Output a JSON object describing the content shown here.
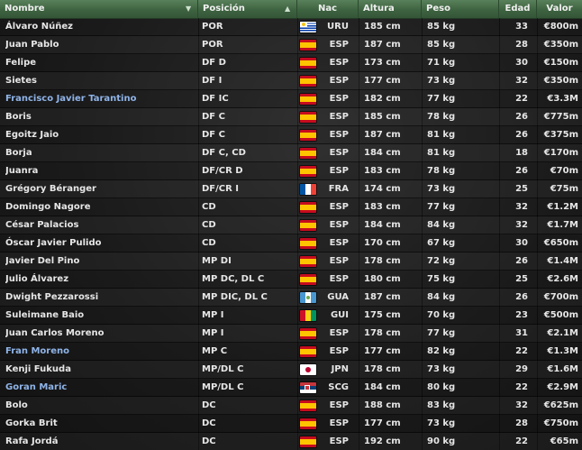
{
  "header": {
    "columns": [
      {
        "key": "nombre",
        "label": "Nombre"
      },
      {
        "key": "posicion",
        "label": "Posición"
      },
      {
        "key": "nac",
        "label": "Nac"
      },
      {
        "key": "altura",
        "label": "Altura"
      },
      {
        "key": "peso",
        "label": "Peso"
      },
      {
        "key": "edad",
        "label": "Edad"
      },
      {
        "key": "valor",
        "label": "Valor"
      }
    ],
    "nombre_filter_icon": "▼",
    "sort_icon": "▲"
  },
  "flags": {
    "ESP": "spain-flag-icon",
    "URU": "uruguay-flag-icon",
    "FRA": "france-flag-icon",
    "GUA": "guatemala-flag-icon",
    "GUI": "guinea-flag-icon",
    "JPN": "japan-flag-icon",
    "SCG": "serbia-montenegro-flag-icon"
  },
  "colors": {
    "header_green": "#4a6f4b",
    "highlight_name": "#8fb4e8",
    "text": "#e6e6e6"
  },
  "players": [
    {
      "nombre": "Álvaro Núñez",
      "posicion": "POR",
      "nac": "URU",
      "altura": "185 cm",
      "peso": "85 kg",
      "edad": "33",
      "valor": "€800m",
      "highlight": false
    },
    {
      "nombre": "Juan Pablo",
      "posicion": "POR",
      "nac": "ESP",
      "altura": "187 cm",
      "peso": "85 kg",
      "edad": "28",
      "valor": "€350m",
      "highlight": false
    },
    {
      "nombre": "Felipe",
      "posicion": "DF D",
      "nac": "ESP",
      "altura": "173 cm",
      "peso": "71 kg",
      "edad": "30",
      "valor": "€150m",
      "highlight": false
    },
    {
      "nombre": "Sietes",
      "posicion": "DF I",
      "nac": "ESP",
      "altura": "177 cm",
      "peso": "73 kg",
      "edad": "32",
      "valor": "€350m",
      "highlight": false
    },
    {
      "nombre": "Francisco Javier Tarantino",
      "posicion": "DF IC",
      "nac": "ESP",
      "altura": "182 cm",
      "peso": "77 kg",
      "edad": "22",
      "valor": "€3.3M",
      "highlight": true
    },
    {
      "nombre": "Boris",
      "posicion": "DF C",
      "nac": "ESP",
      "altura": "185 cm",
      "peso": "78 kg",
      "edad": "26",
      "valor": "€775m",
      "highlight": false
    },
    {
      "nombre": "Egoitz Jaio",
      "posicion": "DF C",
      "nac": "ESP",
      "altura": "187 cm",
      "peso": "81 kg",
      "edad": "26",
      "valor": "€375m",
      "highlight": false
    },
    {
      "nombre": "Borja",
      "posicion": "DF C, CD",
      "nac": "ESP",
      "altura": "184 cm",
      "peso": "81 kg",
      "edad": "18",
      "valor": "€170m",
      "highlight": false
    },
    {
      "nombre": "Juanra",
      "posicion": "DF/CR D",
      "nac": "ESP",
      "altura": "183 cm",
      "peso": "78 kg",
      "edad": "26",
      "valor": "€70m",
      "highlight": false
    },
    {
      "nombre": "Grégory Béranger",
      "posicion": "DF/CR I",
      "nac": "FRA",
      "altura": "174 cm",
      "peso": "73 kg",
      "edad": "25",
      "valor": "€75m",
      "highlight": false
    },
    {
      "nombre": "Domingo Nagore",
      "posicion": "CD",
      "nac": "ESP",
      "altura": "183 cm",
      "peso": "77 kg",
      "edad": "32",
      "valor": "€1.2M",
      "highlight": false
    },
    {
      "nombre": "César Palacios",
      "posicion": "CD",
      "nac": "ESP",
      "altura": "184 cm",
      "peso": "84 kg",
      "edad": "32",
      "valor": "€1.7M",
      "highlight": false
    },
    {
      "nombre": "Óscar Javier Pulido",
      "posicion": "CD",
      "nac": "ESP",
      "altura": "170 cm",
      "peso": "67 kg",
      "edad": "30",
      "valor": "€650m",
      "highlight": false
    },
    {
      "nombre": "Javier Del Pino",
      "posicion": "MP DI",
      "nac": "ESP",
      "altura": "178 cm",
      "peso": "72 kg",
      "edad": "26",
      "valor": "€1.4M",
      "highlight": false
    },
    {
      "nombre": "Julio Álvarez",
      "posicion": "MP DC, DL C",
      "nac": "ESP",
      "altura": "180 cm",
      "peso": "75 kg",
      "edad": "25",
      "valor": "€2.6M",
      "highlight": false
    },
    {
      "nombre": "Dwight Pezzarossi",
      "posicion": "MP DIC, DL C",
      "nac": "GUA",
      "altura": "187 cm",
      "peso": "84 kg",
      "edad": "26",
      "valor": "€700m",
      "highlight": false
    },
    {
      "nombre": "Suleimane Baio",
      "posicion": "MP I",
      "nac": "GUI",
      "altura": "175 cm",
      "peso": "70 kg",
      "edad": "23",
      "valor": "€500m",
      "highlight": false
    },
    {
      "nombre": "Juan Carlos Moreno",
      "posicion": "MP I",
      "nac": "ESP",
      "altura": "178 cm",
      "peso": "77 kg",
      "edad": "31",
      "valor": "€2.1M",
      "highlight": false
    },
    {
      "nombre": "Fran Moreno",
      "posicion": "MP C",
      "nac": "ESP",
      "altura": "177 cm",
      "peso": "82 kg",
      "edad": "22",
      "valor": "€1.3M",
      "highlight": true
    },
    {
      "nombre": "Kenji Fukuda",
      "posicion": "MP/DL C",
      "nac": "JPN",
      "altura": "178 cm",
      "peso": "73 kg",
      "edad": "29",
      "valor": "€1.6M",
      "highlight": false
    },
    {
      "nombre": "Goran Maric",
      "posicion": "MP/DL C",
      "nac": "SCG",
      "altura": "184 cm",
      "peso": "80 kg",
      "edad": "22",
      "valor": "€2.9M",
      "highlight": true
    },
    {
      "nombre": "Bolo",
      "posicion": "DC",
      "nac": "ESP",
      "altura": "188 cm",
      "peso": "83 kg",
      "edad": "32",
      "valor": "€625m",
      "highlight": false
    },
    {
      "nombre": "Gorka Brit",
      "posicion": "DC",
      "nac": "ESP",
      "altura": "177 cm",
      "peso": "73 kg",
      "edad": "28",
      "valor": "€750m",
      "highlight": false
    },
    {
      "nombre": "Rafa Jordá",
      "posicion": "DC",
      "nac": "ESP",
      "altura": "192 cm",
      "peso": "90 kg",
      "edad": "22",
      "valor": "€65m",
      "highlight": false
    }
  ]
}
